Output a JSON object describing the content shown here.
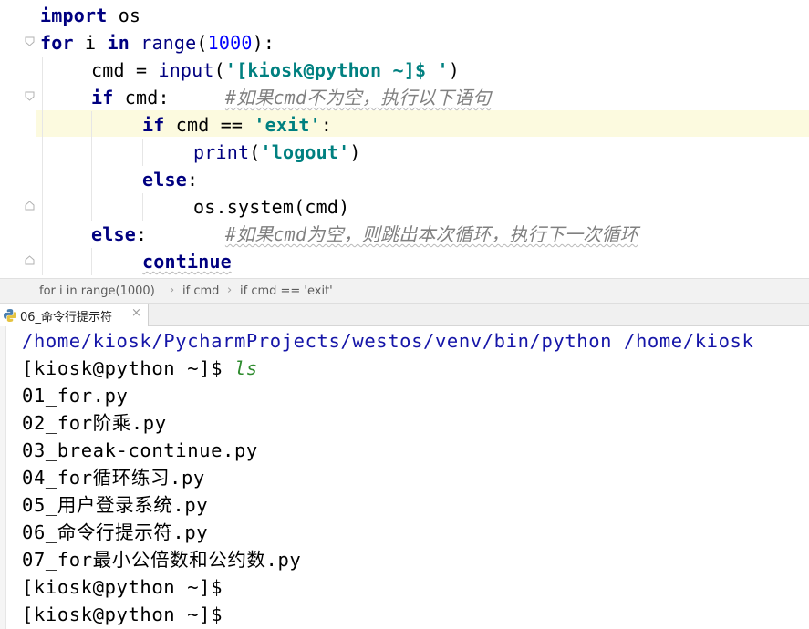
{
  "editor": {
    "lines": [
      {
        "indent": 0,
        "tokens": [
          {
            "t": "import",
            "c": "kw"
          },
          {
            "t": " os",
            "c": ""
          }
        ]
      },
      {
        "indent": 0,
        "tokens": [
          {
            "t": "for",
            "c": "kw"
          },
          {
            "t": " i ",
            "c": ""
          },
          {
            "t": "in",
            "c": "kw"
          },
          {
            "t": " ",
            "c": ""
          },
          {
            "t": "range",
            "c": "bi"
          },
          {
            "t": "(",
            "c": ""
          },
          {
            "t": "1000",
            "c": "num"
          },
          {
            "t": "):",
            "c": ""
          }
        ]
      },
      {
        "indent": 1,
        "tokens": [
          {
            "t": "cmd = ",
            "c": ""
          },
          {
            "t": "input",
            "c": "bi"
          },
          {
            "t": "(",
            "c": ""
          },
          {
            "t": "'[kiosk@python ~]$ '",
            "c": "str"
          },
          {
            "t": ")",
            "c": ""
          }
        ]
      },
      {
        "indent": 1,
        "tokens": [
          {
            "t": "if",
            "c": "kw"
          },
          {
            "t": " cmd:     ",
            "c": ""
          },
          {
            "t": "#如果cmd不为空，执行以下语句",
            "c": "cmt squiggle"
          }
        ]
      },
      {
        "indent": 2,
        "tokens": [
          {
            "t": "if",
            "c": "kw"
          },
          {
            "t": " cmd == ",
            "c": ""
          },
          {
            "t": "'exit'",
            "c": "str"
          },
          {
            "t": ":",
            "c": ""
          }
        ]
      },
      {
        "indent": 3,
        "tokens": [
          {
            "t": "print",
            "c": "bi"
          },
          {
            "t": "(",
            "c": ""
          },
          {
            "t": "'logout'",
            "c": "str"
          },
          {
            "t": ")",
            "c": ""
          }
        ]
      },
      {
        "indent": 2,
        "tokens": [
          {
            "t": "else",
            "c": "kw"
          },
          {
            "t": ":",
            "c": ""
          }
        ]
      },
      {
        "indent": 3,
        "tokens": [
          {
            "t": "os.system(cmd)",
            "c": ""
          }
        ]
      },
      {
        "indent": 1,
        "tokens": [
          {
            "t": "else",
            "c": "kw"
          },
          {
            "t": ":       ",
            "c": ""
          },
          {
            "t": "#如果cmd为空，则跳出本次循环，执行下一次循环",
            "c": "cmt squiggle"
          }
        ]
      },
      {
        "indent": 2,
        "tokens": [
          {
            "t": "continue",
            "c": "kw squiggle"
          }
        ]
      }
    ]
  },
  "breadcrumb": {
    "items": [
      "for i in range(1000)",
      "if cmd",
      "if cmd == 'exit'"
    ],
    "separator": "›"
  },
  "run_tab": {
    "label": "06_命令行提示符",
    "close": "×",
    "icon": "python-file-icon"
  },
  "console": {
    "lines": [
      {
        "text": "/home/kiosk/PycharmProjects/westos/venv/bin/python /home/kiosk",
        "kind": "cmd-path"
      },
      {
        "text": "[kiosk@python ~]$ ",
        "input": "ls",
        "kind": "prompt"
      },
      {
        "text": "01_for.py",
        "kind": "out"
      },
      {
        "text": "02_for阶乘.py",
        "kind": "out"
      },
      {
        "text": "03_break-continue.py",
        "kind": "out"
      },
      {
        "text": "04_for循环练习.py",
        "kind": "out"
      },
      {
        "text": "05_用户登录系统.py",
        "kind": "out"
      },
      {
        "text": "06_命令行提示符.py",
        "kind": "out"
      },
      {
        "text": "07_for最小公倍数和公约数.py",
        "kind": "out"
      },
      {
        "text": "[kiosk@python ~]$",
        "kind": "prompt"
      },
      {
        "text": "[kiosk@python ~]$",
        "kind": "prompt"
      }
    ]
  },
  "colors": {
    "keyword": "#000080",
    "string": "#008080",
    "number": "#0000ff",
    "comment": "#808080",
    "caret_row": "#fcfadf",
    "console_path": "#1515a8",
    "user_input": "#2e8b2e"
  }
}
